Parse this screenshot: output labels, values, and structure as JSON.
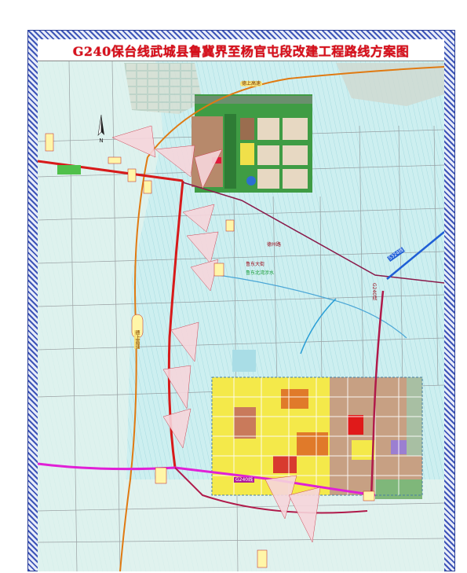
{
  "title": "G240保台线武城县鲁冀界至杨官屯段改建工程路线方案图",
  "labels": {
    "expressway_north": "德上高速",
    "expressway_west": "德上高速",
    "g240_label": "G240线",
    "s324_label": "S324线",
    "lucheng_road": "鲁东大街",
    "village_note": "鲁东北湾涉水",
    "new_route_a": "德州路",
    "south_label": "G240线"
  },
  "colors": {
    "title": "#d8101d",
    "route_red": "#d71a1a",
    "expressway_orange": "#e07a12",
    "g240_magenta": "#e020d6",
    "s324_blue": "#1f5fd6",
    "frame_blue": "#3d55b8",
    "water_cyan": "#bfe9ee",
    "urban_yellow": "#f4e94a",
    "urban_brown": "#c7a083",
    "green_zone": "#4fae48"
  },
  "icons": {
    "compass": "north-arrow-icon"
  }
}
